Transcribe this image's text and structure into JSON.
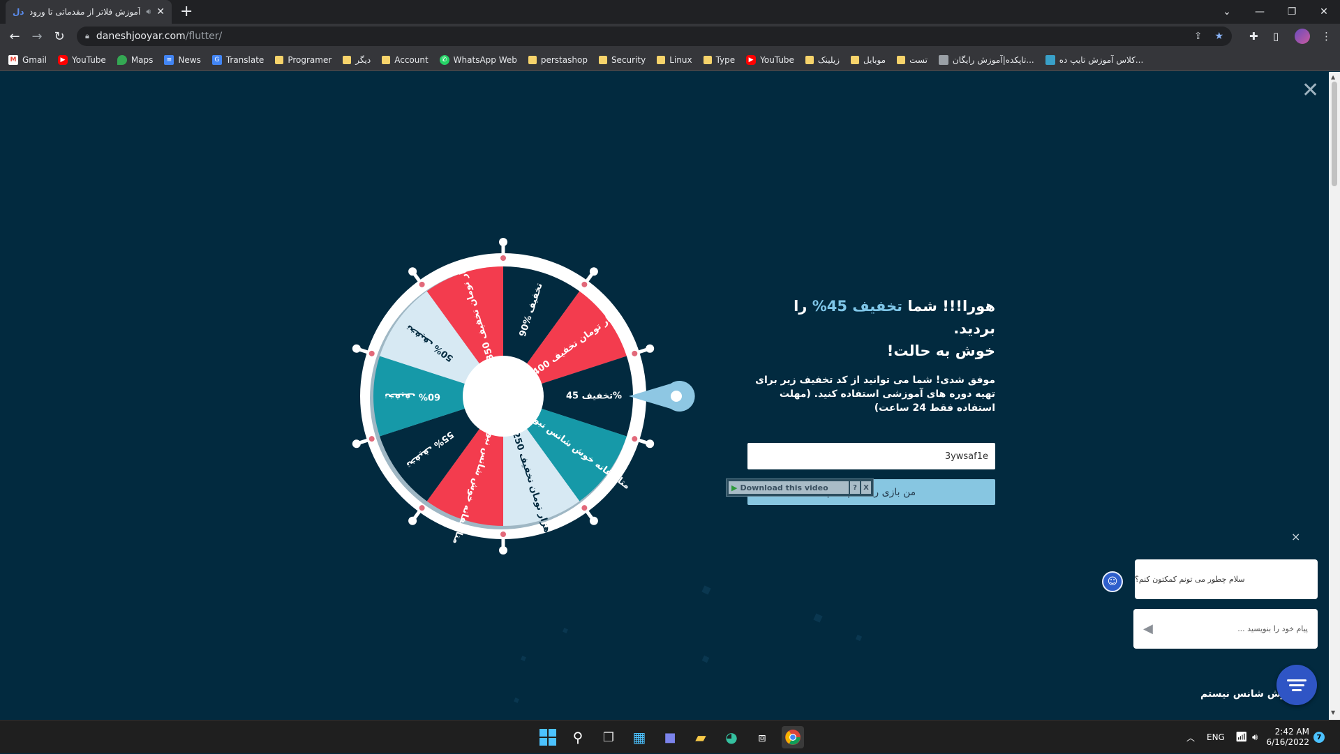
{
  "browser": {
    "tab_title": "آموزش فلاتر از مقدماتی تا ورود",
    "tab_favicon": "دل",
    "new_tab": "+",
    "url_host": "daneshjooyar.com",
    "url_path": "/flutter/",
    "bookmarks": [
      {
        "label": "Gmail",
        "icon": "gmail-icon"
      },
      {
        "label": "YouTube",
        "icon": "youtube-icon"
      },
      {
        "label": "Maps",
        "icon": "maps-icon"
      },
      {
        "label": "News",
        "icon": "news-icon"
      },
      {
        "label": "Translate",
        "icon": "translate-icon"
      },
      {
        "label": "Programer",
        "icon": "folder-icon"
      },
      {
        "label": "دیگر",
        "icon": "folder-icon"
      },
      {
        "label": "Account",
        "icon": "folder-icon"
      },
      {
        "label": "WhatsApp Web",
        "icon": "whatsapp-icon"
      },
      {
        "label": "perstashop",
        "icon": "folder-icon"
      },
      {
        "label": "Security",
        "icon": "folder-icon"
      },
      {
        "label": "Linux",
        "icon": "folder-icon"
      },
      {
        "label": "Type",
        "icon": "folder-icon"
      },
      {
        "label": "YouTube",
        "icon": "youtube-icon"
      },
      {
        "label": "زیلینک",
        "icon": "folder-icon"
      },
      {
        "label": "موبایل",
        "icon": "folder-icon"
      },
      {
        "label": "تست",
        "icon": "folder-icon"
      },
      {
        "label": "تاپکده|آموزش رایگان...",
        "icon": "page-icon"
      },
      {
        "label": "کلاس آموزش تایپ ده...",
        "icon": "typing-class-icon"
      }
    ]
  },
  "wheel": {
    "colors": {
      "red": "#f33c4e",
      "dark": "#022a3f",
      "teal": "#1699a8",
      "light": "#d7e9f3",
      "rim": "#ffffff",
      "peg": "#e2697a",
      "pointer": "#8ec7e3"
    },
    "segments": [
      {
        "label": "90% تخفیف",
        "color": "dark"
      },
      {
        "label": "400 هزار تومان تخفیف",
        "color": "red"
      },
      {
        "label": "تخفیف 45%",
        "color": "dark"
      },
      {
        "label": "متاسفانه خوش شانس نبودی",
        "color": "teal"
      },
      {
        "label": "250 هزار تومان تخفیف",
        "color": "light"
      },
      {
        "label": "متاسفانه خوش شانس نبودی",
        "color": "red"
      },
      {
        "label": "55% تخفیف",
        "color": "dark"
      },
      {
        "label": "60% تخفیف",
        "color": "teal"
      },
      {
        "label": "50% تخفیف",
        "color": "light"
      },
      {
        "label": "350 هزار تومان تخفیف",
        "color": "red"
      }
    ]
  },
  "result": {
    "title_pre": "هورا!!! شما",
    "title_highlight": "تخفیف 45%",
    "title_post": "را بردید.",
    "title_line2": "خوش به حالت!",
    "description": "موفق شدی! شما می توانید از کد تخفیف زیر برای تهیه دوره های آموزشی استفاده کنید. (مهلت استفاده فقط 24 ساعت)",
    "coupon_code": "3ywsaf1e",
    "done_button": "من بازی را انجام دادم"
  },
  "video_helper": {
    "label": "Download this video",
    "help": "?",
    "close": "X"
  },
  "chat": {
    "greeting": "سلام چطور می تونم کمکتون کنم؟",
    "input_placeholder": "پیام خود را بنویسید ...",
    "close": "×"
  },
  "bottom_link": "خوش شانس نیستم",
  "taskbar": {
    "language": "ENG",
    "time": "2:42 AM",
    "date": "6/16/2022",
    "notifications": "7"
  }
}
